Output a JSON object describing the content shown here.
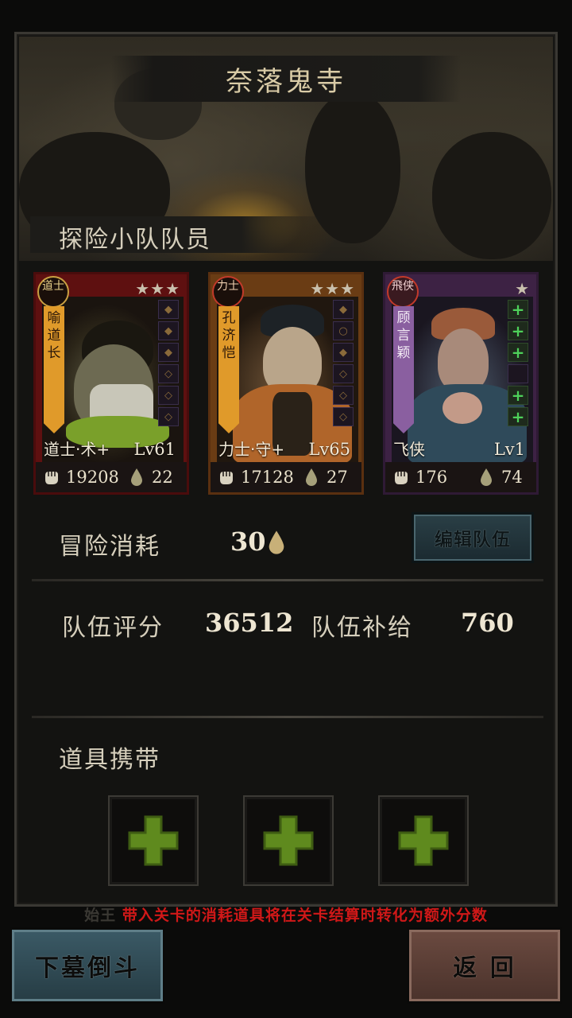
{
  "stage": {
    "title": "奈落鬼寺"
  },
  "team_section": {
    "label": "探险小队队员"
  },
  "members": [
    {
      "badge": "道士",
      "name": "喻道长",
      "class_label": "道士·术+",
      "level": "Lv61",
      "power": "19208",
      "cost": "22",
      "stars": "★★★",
      "theme": "red",
      "gear": [
        "equip-ring-icon",
        "equip-boot-icon",
        "equip-fan-icon",
        "equip-gem-icon",
        "equip-orb-icon",
        "equip-scroll-icon"
      ]
    },
    {
      "badge": "力士",
      "name": "孔济恺",
      "class_label": "力士·守+",
      "level": "Lv65",
      "power": "17128",
      "cost": "27",
      "stars": "★★★",
      "theme": "orange",
      "gear": [
        "equip-knife-icon",
        "equip-ring-icon",
        "equip-blade-icon",
        "equip-gem-icon",
        "equip-orb-icon",
        "equip-scroll-icon"
      ]
    },
    {
      "badge": "飛侠",
      "name": "顾言颖",
      "class_label": "飞侠",
      "level": "Lv1",
      "power": "176",
      "cost": "74",
      "stars": "★",
      "theme": "purple",
      "gear": [
        "add-icon",
        "add-icon",
        "add-icon",
        "empty-icon",
        "add-icon",
        "add-icon"
      ]
    }
  ],
  "adventure": {
    "cost_label": "冒险消耗",
    "cost_value": "30"
  },
  "edit_team_button": "编辑队伍",
  "team_stats": {
    "score_label": "队伍评分",
    "score_value": "36512",
    "supply_label": "队伍补给",
    "supply_value": "760"
  },
  "items_section": {
    "label": "道具携带",
    "slots": [
      "add-icon",
      "add-icon",
      "add-icon"
    ]
  },
  "notice": {
    "prefix": "始王",
    "text": "带入关卡的消耗道具将在关卡结算时转化为额外分数"
  },
  "buttons": {
    "start": "下墓倒斗",
    "back": "返 回"
  },
  "colors": {
    "accent_green": "#4ed15a",
    "notice_red": "#d01818",
    "title_text": "#d9cba6"
  }
}
